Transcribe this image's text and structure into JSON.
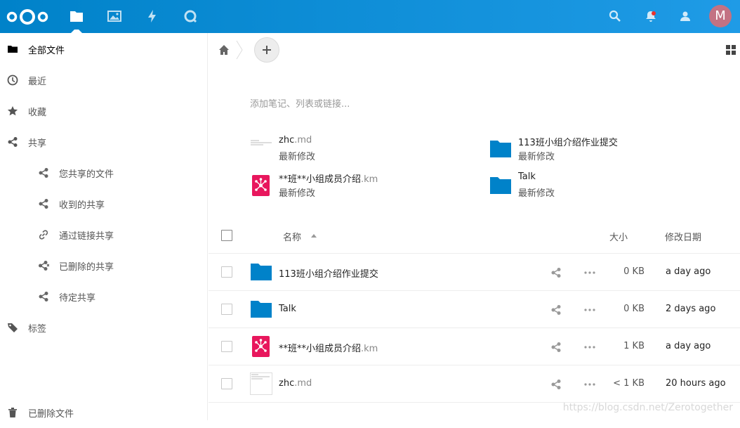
{
  "header": {
    "avatar_letter": "M",
    "apps": [
      "files-icon",
      "photos-icon",
      "activity-icon",
      "talk-icon"
    ],
    "accent_color": "#0082c9"
  },
  "sidebar": {
    "items": [
      {
        "label": "全部文件",
        "icon": "folder-icon"
      },
      {
        "label": "最近",
        "icon": "clock-icon"
      },
      {
        "label": "收藏",
        "icon": "star-icon"
      },
      {
        "label": "共享",
        "icon": "share-icon"
      },
      {
        "label": "您共享的文件",
        "icon": "share-icon"
      },
      {
        "label": "收到的共享",
        "icon": "share-icon"
      },
      {
        "label": "通过链接共享",
        "icon": "link-icon"
      },
      {
        "label": "已删除的共享",
        "icon": "deleted-share-icon"
      },
      {
        "label": "待定共享",
        "icon": "share-icon"
      },
      {
        "label": "标签",
        "icon": "tag-icon"
      },
      {
        "label": "已删除文件",
        "icon": "trash-icon"
      }
    ]
  },
  "main": {
    "note_placeholder": "添加笔记、列表或链接...",
    "recent": [
      {
        "name": "zhc",
        "ext": ".md",
        "sub": "最新修改",
        "type": "text"
      },
      {
        "name": "113班小组介绍作业提交",
        "ext": "",
        "sub": "最新修改",
        "type": "folder"
      },
      {
        "name": "**班**小组成员介绍",
        "ext": ".km",
        "sub": "最新修改",
        "type": "mindmap"
      },
      {
        "name": "Talk",
        "ext": "",
        "sub": "最新修改",
        "type": "folder"
      }
    ],
    "table": {
      "col_name": "名称",
      "col_size": "大小",
      "col_modified": "修改日期",
      "rows": [
        {
          "name": "113班小组介绍作业提交",
          "ext": "",
          "size": "0 KB",
          "modified": "a day ago",
          "type": "folder"
        },
        {
          "name": "Talk",
          "ext": "",
          "size": "0 KB",
          "modified": "2 days ago",
          "type": "folder"
        },
        {
          "name": "**班**小组成员介绍",
          "ext": ".km",
          "size": "1 KB",
          "modified": "a day ago",
          "type": "mindmap"
        },
        {
          "name": "zhc",
          "ext": ".md",
          "size": "< 1 KB",
          "modified": "20 hours ago",
          "type": "text"
        }
      ]
    }
  },
  "watermark": "https://blog.csdn.net/Zerotogether"
}
